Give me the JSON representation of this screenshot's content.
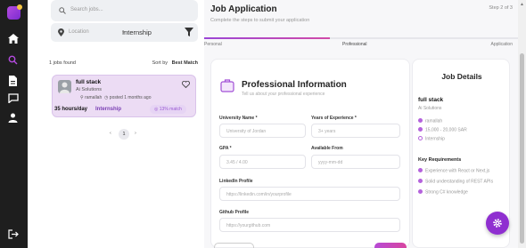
{
  "colors": {
    "rail": "#1e1e1e",
    "brand": "#9b45d6",
    "accent_pink": "#d14aa8",
    "card_selected": "#ecdcf4"
  },
  "rail": {
    "icons": [
      "logo-icon",
      "home-icon",
      "search-icon",
      "document-icon",
      "chat-icon",
      "user-icon",
      "logout-icon"
    ],
    "active": "search-icon"
  },
  "search": {
    "placeholder": "Search jobs...",
    "location_placeholder": "Location",
    "job_type_value": "Internship"
  },
  "results": {
    "count_text": "1 jobs found",
    "sort_label": "Sort by",
    "sort_value": "Best Match"
  },
  "job_card": {
    "title": "full stack",
    "company": "Ai Solutions",
    "location": "ramallah",
    "posted": "posted 1 months ago",
    "hours": "35 hours/day",
    "type": "Internship",
    "match": "13% match",
    "match_fraction": 0.13
  },
  "pagination": {
    "prev": "‹",
    "current": "1",
    "next": "›"
  },
  "application": {
    "title": "Job Application",
    "subtitle": "Complete the steps to submit your application",
    "step_text": "Step 2 of 3",
    "progress_fraction": 0.4,
    "steps": [
      "Personal",
      "Professional",
      "Application"
    ],
    "form_title": "Professional Information",
    "form_subtitle": "Tell us about your professional experience",
    "fields": {
      "university_label": "University Name *",
      "university_placeholder": "University of Jordan",
      "experience_label": "Years of Experience *",
      "experience_placeholder": "3+ years",
      "gpa_label": "GPA *",
      "gpa_placeholder": "3.45 / 4.00",
      "available_label": "Available From",
      "available_placeholder": "yyyy-mm-dd",
      "linkedin_label": "LinkedIn Profile",
      "linkedin_placeholder": "https://linkedin.com/in/yourprofile",
      "github_label": "Github Profile",
      "github_placeholder": "https://yourgithub.com"
    }
  },
  "details": {
    "heading": "Job Details",
    "title": "full stack",
    "company": "Ai Solutions",
    "location": "ramallah",
    "salary": "15,000 - 20,000 SAR",
    "type": "Internship",
    "requirements_heading": "Key Requirements",
    "requirements": [
      "Experience with React or Next.js",
      "Solid understanding of REST APIs",
      "Strong C# knowledge"
    ]
  }
}
